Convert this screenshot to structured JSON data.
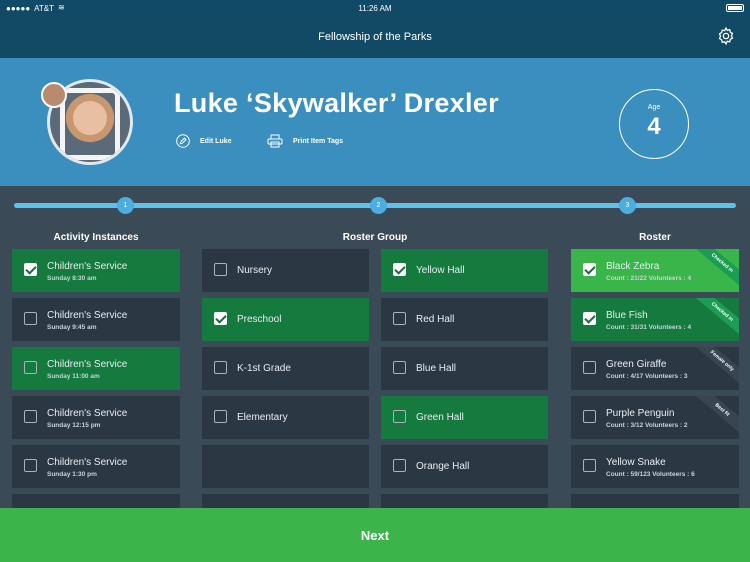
{
  "status": {
    "carrier": "AT&T",
    "time": "11:26 AM"
  },
  "nav": {
    "title": "Fellowship of the Parks"
  },
  "profile": {
    "name": "Luke ‘Skywalker’ Drexler",
    "edit_label": "Edit Luke",
    "print_label": "Print Item Tags",
    "age_label": "Age",
    "age_value": "4"
  },
  "steps": [
    "1",
    "2",
    "3"
  ],
  "columns": {
    "activity": "Activity Instances",
    "roster_group": "Roster Group",
    "roster": "Roster"
  },
  "activity_instances": [
    {
      "title": "Children's Service",
      "time": "Sunday 8:30 am",
      "checked": true
    },
    {
      "title": "Children's Service",
      "time": "Sunday 9:45 am",
      "checked": false
    },
    {
      "title": "Children's Service",
      "time": "Sunday 11:00 am",
      "checked": false
    },
    {
      "title": "Children's Service",
      "time": "Sunday 12:15 pm",
      "checked": false
    },
    {
      "title": "Children's Service",
      "time": "Sunday 1:30 pm",
      "checked": false
    }
  ],
  "roster_groups_left": [
    {
      "title": "Nursery",
      "checked": false
    },
    {
      "title": "Preschool",
      "checked": true
    },
    {
      "title": "K-1st Grade",
      "checked": false
    },
    {
      "title": "Elementary",
      "checked": false
    }
  ],
  "roster_groups_right": [
    {
      "title": "Yellow Hall",
      "checked": true
    },
    {
      "title": "Red Hall",
      "checked": false
    },
    {
      "title": "Blue Hall",
      "checked": false
    },
    {
      "title": "Green Hall",
      "checked": false
    },
    {
      "title": "Orange Hall",
      "checked": false
    }
  ],
  "rosters": [
    {
      "title": "Black Zebra",
      "meta": "Count : 21/22  Volunteers : 4",
      "checked": true,
      "tag": "Checked in"
    },
    {
      "title": "Blue Fish",
      "meta": "Count : 31/31  Volunteers : 4",
      "checked": true,
      "tag": "Checked in"
    },
    {
      "title": "Green Giraffe",
      "meta": "Count : 4/17  Volunteers : 3",
      "checked": false,
      "tag": "Female only"
    },
    {
      "title": "Purple Penguin",
      "meta": "Count : 3/12  Volunteers : 2",
      "checked": false,
      "tag": "Best fit"
    },
    {
      "title": "Yellow Snake",
      "meta": "Count : 59/123  Volunteers : 6",
      "checked": false,
      "tag": ""
    }
  ],
  "footer": {
    "next_label": "Next"
  },
  "colors": {
    "header": "#124a66",
    "profile": "#3b8fbf",
    "accent_green": "#3bb54a",
    "selected_green": "#147a3d",
    "card": "#2c3744"
  }
}
